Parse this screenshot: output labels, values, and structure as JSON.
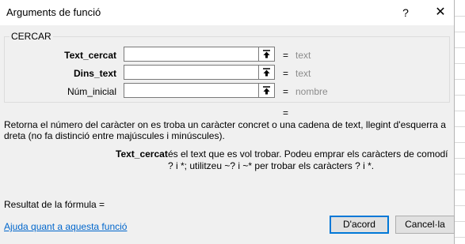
{
  "dialog": {
    "title": "Arguments de funció",
    "help_label": "?",
    "close_label": "✕"
  },
  "function": {
    "name": "CERCAR",
    "args": [
      {
        "label": "Text_cercat",
        "value": "",
        "eq": "=",
        "hint": "text",
        "bold": true
      },
      {
        "label": "Dins_text",
        "value": "",
        "eq": "=",
        "hint": "text",
        "bold": true
      },
      {
        "label": "Núm_inicial",
        "value": "",
        "eq": "=",
        "hint": "nombre",
        "bold": false
      }
    ],
    "result_eq": "=",
    "description": "Retorna el número del caràcter on es troba un caràcter concret o una cadena de text, llegint d'esquerra a dreta (no fa distinció entre majúscules i minúscules).",
    "arg_help": {
      "label": "Text_cercat",
      "text": "és el text que es vol trobar. Podeu emprar els caràcters de comodí ? i *; utilitzeu ~? i ~* per trobar els caràcters ? i *."
    }
  },
  "footer": {
    "formula_result": "Resultat de la fórmula =",
    "help_link": "Ajuda quant a aquesta funció",
    "ok_label": "D'acord",
    "cancel_label": "Cancel·la"
  },
  "icons": {
    "ref": "collapse-ref-icon"
  }
}
